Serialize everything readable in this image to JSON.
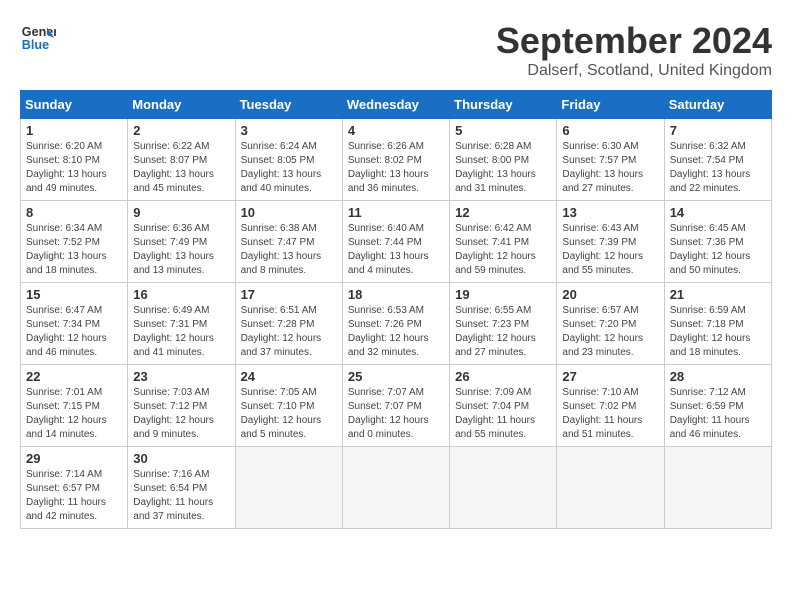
{
  "header": {
    "logo_line1": "General",
    "logo_line2": "Blue",
    "month": "September 2024",
    "location": "Dalserf, Scotland, United Kingdom"
  },
  "weekdays": [
    "Sunday",
    "Monday",
    "Tuesday",
    "Wednesday",
    "Thursday",
    "Friday",
    "Saturday"
  ],
  "weeks": [
    [
      {
        "day": "1",
        "info": "Sunrise: 6:20 AM\nSunset: 8:10 PM\nDaylight: 13 hours\nand 49 minutes."
      },
      {
        "day": "2",
        "info": "Sunrise: 6:22 AM\nSunset: 8:07 PM\nDaylight: 13 hours\nand 45 minutes."
      },
      {
        "day": "3",
        "info": "Sunrise: 6:24 AM\nSunset: 8:05 PM\nDaylight: 13 hours\nand 40 minutes."
      },
      {
        "day": "4",
        "info": "Sunrise: 6:26 AM\nSunset: 8:02 PM\nDaylight: 13 hours\nand 36 minutes."
      },
      {
        "day": "5",
        "info": "Sunrise: 6:28 AM\nSunset: 8:00 PM\nDaylight: 13 hours\nand 31 minutes."
      },
      {
        "day": "6",
        "info": "Sunrise: 6:30 AM\nSunset: 7:57 PM\nDaylight: 13 hours\nand 27 minutes."
      },
      {
        "day": "7",
        "info": "Sunrise: 6:32 AM\nSunset: 7:54 PM\nDaylight: 13 hours\nand 22 minutes."
      }
    ],
    [
      {
        "day": "8",
        "info": "Sunrise: 6:34 AM\nSunset: 7:52 PM\nDaylight: 13 hours\nand 18 minutes."
      },
      {
        "day": "9",
        "info": "Sunrise: 6:36 AM\nSunset: 7:49 PM\nDaylight: 13 hours\nand 13 minutes."
      },
      {
        "day": "10",
        "info": "Sunrise: 6:38 AM\nSunset: 7:47 PM\nDaylight: 13 hours\nand 8 minutes."
      },
      {
        "day": "11",
        "info": "Sunrise: 6:40 AM\nSunset: 7:44 PM\nDaylight: 13 hours\nand 4 minutes."
      },
      {
        "day": "12",
        "info": "Sunrise: 6:42 AM\nSunset: 7:41 PM\nDaylight: 12 hours\nand 59 minutes."
      },
      {
        "day": "13",
        "info": "Sunrise: 6:43 AM\nSunset: 7:39 PM\nDaylight: 12 hours\nand 55 minutes."
      },
      {
        "day": "14",
        "info": "Sunrise: 6:45 AM\nSunset: 7:36 PM\nDaylight: 12 hours\nand 50 minutes."
      }
    ],
    [
      {
        "day": "15",
        "info": "Sunrise: 6:47 AM\nSunset: 7:34 PM\nDaylight: 12 hours\nand 46 minutes."
      },
      {
        "day": "16",
        "info": "Sunrise: 6:49 AM\nSunset: 7:31 PM\nDaylight: 12 hours\nand 41 minutes."
      },
      {
        "day": "17",
        "info": "Sunrise: 6:51 AM\nSunset: 7:28 PM\nDaylight: 12 hours\nand 37 minutes."
      },
      {
        "day": "18",
        "info": "Sunrise: 6:53 AM\nSunset: 7:26 PM\nDaylight: 12 hours\nand 32 minutes."
      },
      {
        "day": "19",
        "info": "Sunrise: 6:55 AM\nSunset: 7:23 PM\nDaylight: 12 hours\nand 27 minutes."
      },
      {
        "day": "20",
        "info": "Sunrise: 6:57 AM\nSunset: 7:20 PM\nDaylight: 12 hours\nand 23 minutes."
      },
      {
        "day": "21",
        "info": "Sunrise: 6:59 AM\nSunset: 7:18 PM\nDaylight: 12 hours\nand 18 minutes."
      }
    ],
    [
      {
        "day": "22",
        "info": "Sunrise: 7:01 AM\nSunset: 7:15 PM\nDaylight: 12 hours\nand 14 minutes."
      },
      {
        "day": "23",
        "info": "Sunrise: 7:03 AM\nSunset: 7:12 PM\nDaylight: 12 hours\nand 9 minutes."
      },
      {
        "day": "24",
        "info": "Sunrise: 7:05 AM\nSunset: 7:10 PM\nDaylight: 12 hours\nand 5 minutes."
      },
      {
        "day": "25",
        "info": "Sunrise: 7:07 AM\nSunset: 7:07 PM\nDaylight: 12 hours\nand 0 minutes."
      },
      {
        "day": "26",
        "info": "Sunrise: 7:09 AM\nSunset: 7:04 PM\nDaylight: 11 hours\nand 55 minutes."
      },
      {
        "day": "27",
        "info": "Sunrise: 7:10 AM\nSunset: 7:02 PM\nDaylight: 11 hours\nand 51 minutes."
      },
      {
        "day": "28",
        "info": "Sunrise: 7:12 AM\nSunset: 6:59 PM\nDaylight: 11 hours\nand 46 minutes."
      }
    ],
    [
      {
        "day": "29",
        "info": "Sunrise: 7:14 AM\nSunset: 6:57 PM\nDaylight: 11 hours\nand 42 minutes."
      },
      {
        "day": "30",
        "info": "Sunrise: 7:16 AM\nSunset: 6:54 PM\nDaylight: 11 hours\nand 37 minutes."
      },
      {
        "day": "",
        "info": ""
      },
      {
        "day": "",
        "info": ""
      },
      {
        "day": "",
        "info": ""
      },
      {
        "day": "",
        "info": ""
      },
      {
        "day": "",
        "info": ""
      }
    ]
  ]
}
